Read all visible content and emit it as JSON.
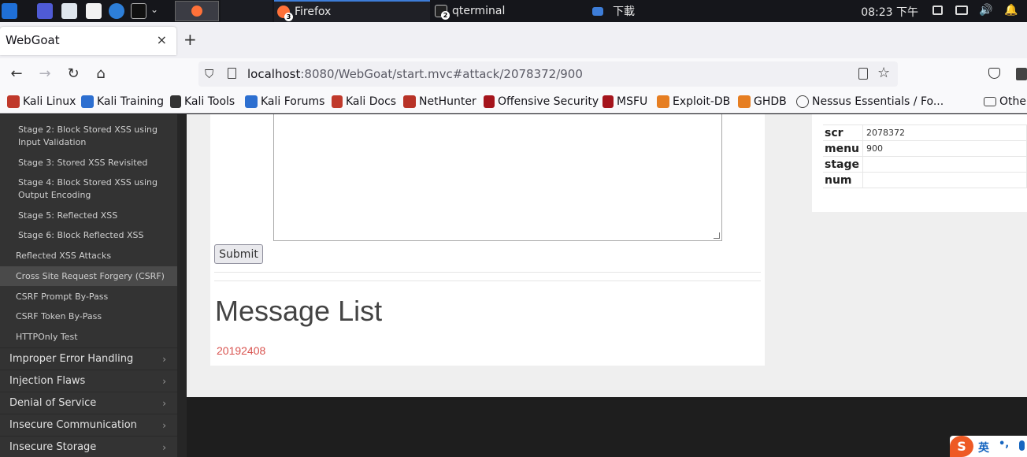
{
  "taskbar": {
    "tasks": [
      {
        "label": "Firefox",
        "badge": "3"
      },
      {
        "label": "qterminal",
        "badge": "2"
      },
      {
        "label": "下載"
      }
    ],
    "clock": "08:23 下午"
  },
  "browser": {
    "tab_title": "WebGoat",
    "tab_close": "×",
    "new_tab": "+",
    "url_host": "localhost",
    "url_rest": ":8080/WebGoat/start.mvc#attack/2078372/900",
    "bookmarks": [
      "Kali Linux",
      "Kali Training",
      "Kali Tools",
      "Kali Forums",
      "Kali Docs",
      "NetHunter",
      "Offensive Security",
      "MSFU",
      "Exploit-DB",
      "GHDB",
      "Nessus Essentials / Fo...",
      "Other"
    ]
  },
  "sidebar": {
    "sub_items": [
      "Stage 2: Block Stored XSS using Input Validation",
      "Stage 3: Stored XSS Revisited",
      "Stage 4: Block Stored XSS using Output Encoding",
      "Stage 5: Reflected XSS",
      "Stage 6: Block Reflected XSS"
    ],
    "lessons": [
      "Reflected XSS Attacks",
      "Cross Site Request Forgery (CSRF)",
      "CSRF Prompt By-Pass",
      "CSRF Token By-Pass",
      "HTTPOnly Test"
    ],
    "categories": [
      "Improper Error Handling",
      "Injection Flaws",
      "Denial of Service",
      "Insecure Communication",
      "Insecure Storage"
    ],
    "chevron": "›"
  },
  "main": {
    "submit_label": "Submit",
    "message_list_title": "Message List",
    "messages": [
      "20192408"
    ]
  },
  "params": [
    {
      "key": "scr",
      "value": "2078372"
    },
    {
      "key": "menu",
      "value": "900"
    },
    {
      "key": "stage",
      "value": ""
    },
    {
      "key": "num",
      "value": ""
    }
  ],
  "ime": {
    "mode": "英",
    "punct": "•,"
  },
  "colors": {
    "sidebar_bg": "#333333",
    "message_red": "#d9534f",
    "taskbar_bg": "#15161b"
  }
}
